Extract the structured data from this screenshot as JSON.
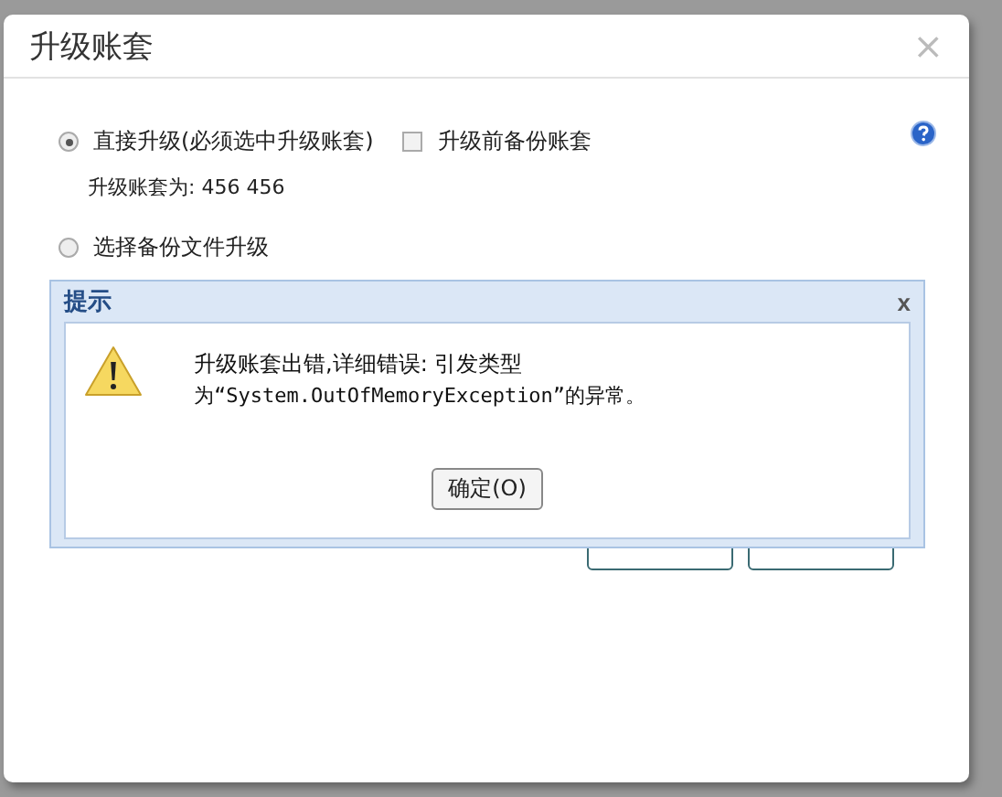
{
  "dialog": {
    "title": "升级账套",
    "close": "×",
    "modes": [
      {
        "label": "直接升级(必须选中升级账套)",
        "selected": true
      },
      {
        "label": "选择备份文件升级",
        "selected": false
      }
    ],
    "backup_checkbox": {
      "label": "升级前备份账套",
      "checked": false
    },
    "account_line": "升级账套为: 456 456"
  },
  "message_box": {
    "title": "提示",
    "close": "x",
    "lines": [
      "升级账套出错,详细错误:  引发类型",
      "为“System.OutOfMemoryException”的异常。"
    ],
    "button": "确定(O)"
  }
}
